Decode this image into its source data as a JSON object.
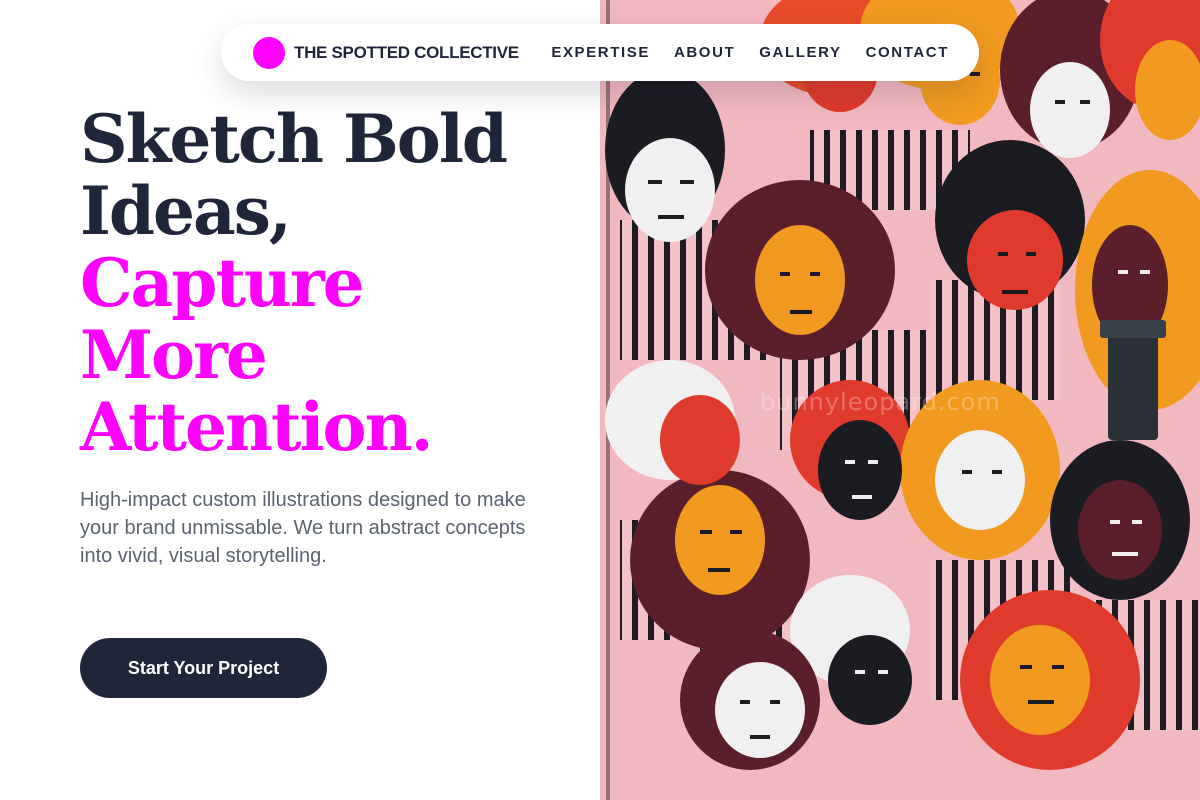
{
  "nav": {
    "brand": "THE SPOTTED COLLECTIVE",
    "links": [
      "EXPERTISE",
      "ABOUT",
      "GALLERY",
      "CONTACT"
    ]
  },
  "hero": {
    "headline_lines": [
      "Sketch Bold",
      "Ideas,",
      "Capture",
      "More",
      "Attention."
    ],
    "description": "High-impact custom illustrations designed to make your brand unmissable. We turn abstract concepts into vivid, visual storytelling.",
    "cta_label": "Start Your Project"
  },
  "illustration": {
    "watermark": "bunnyleopard.com"
  },
  "colors": {
    "accent": "#ff00ff",
    "ink": "#1f2639",
    "muted": "#5b6271",
    "mural_pink": "#f2b8c0"
  }
}
